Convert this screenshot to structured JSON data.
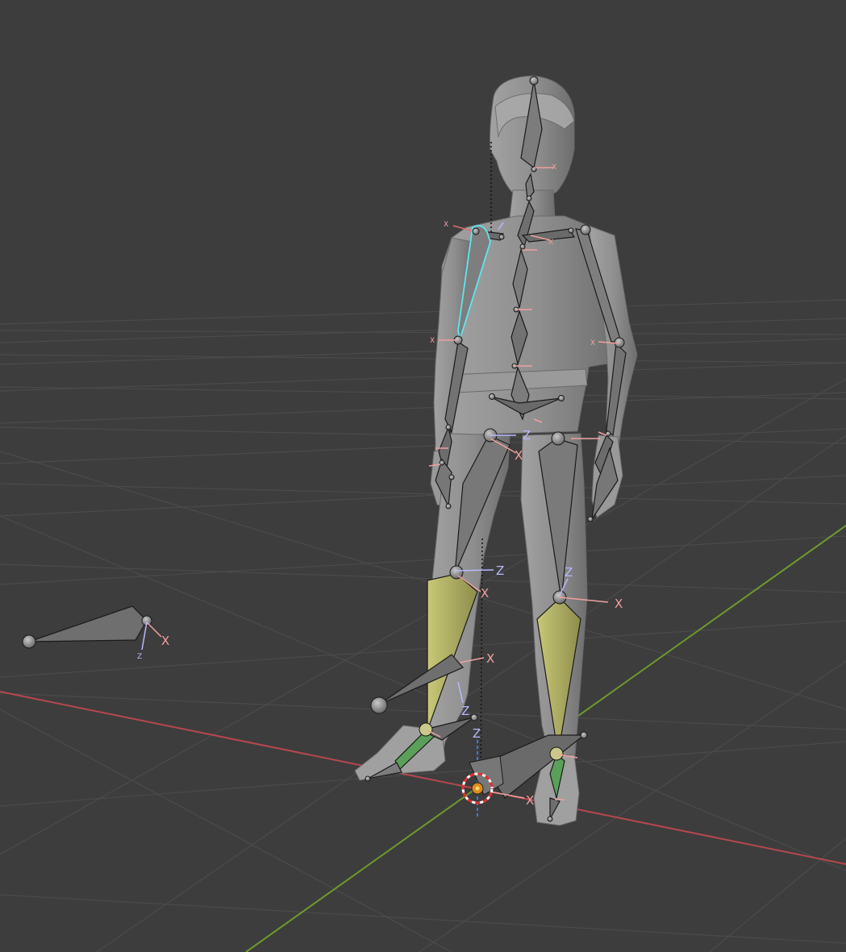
{
  "viewport": {
    "colors": {
      "background": "#3d3d3d",
      "grid": "#4a4a4a",
      "axis_x": "#b7474f",
      "axis_y": "#6d9a2c",
      "mesh": "#8a8a8a",
      "bone": "#7a7a7a",
      "bone_selected_outline": "#5fe6ee",
      "bone_ik": "#b3b365",
      "bone_foot": "#5aa05a",
      "x_label": "#f0a0a0",
      "z_label": "#b8b8ff"
    },
    "axis_labels": {
      "x": "X",
      "z": "Z"
    },
    "icons": [
      "3d-cursor-icon",
      "origin-icon"
    ]
  }
}
